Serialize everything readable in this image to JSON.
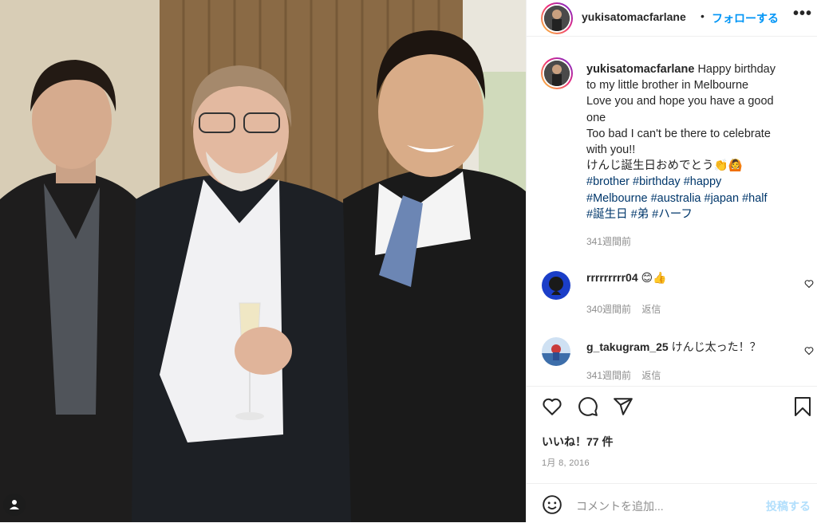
{
  "photo": {
    "alt_badge_icon": "person-tag-icon"
  },
  "header": {
    "username": "yukisatomacfarlane",
    "separator": "•",
    "follow_label": "フォローする",
    "more_label": "•••"
  },
  "caption": {
    "username": "yukisatomacfarlane",
    "lines": [
      "Happy birthday",
      "to my little brother in Melbourne",
      "Love you and hope you have a good",
      "one",
      "Too bad I can't be there to celebrate",
      "with you!!",
      "けんじ誕生日おめでとう👏🙆"
    ],
    "hashtag_lines": [
      "#brother #birthday #happy",
      "#Melbourne #australia #japan #half",
      "#誕生日 #弟 #ハーフ"
    ],
    "time": "341週間前"
  },
  "comments": [
    {
      "username": "rrrrrrrrr04",
      "text": "😊👍",
      "time": "340週間前",
      "reply": "返信"
    },
    {
      "username": "g_takugram_25",
      "text": "けんじ太った！？",
      "time": "341週間前",
      "reply": "返信"
    }
  ],
  "actions": {
    "like_icon": "heart-icon",
    "comment_icon": "comment-icon",
    "share_icon": "send-icon",
    "save_icon": "bookmark-icon"
  },
  "likes": "いいね！77 件",
  "date": "1月 8, 2016",
  "add_comment": {
    "emoji_icon": "smiley-icon",
    "placeholder": "コメントを追加...",
    "post_label": "投稿する"
  }
}
